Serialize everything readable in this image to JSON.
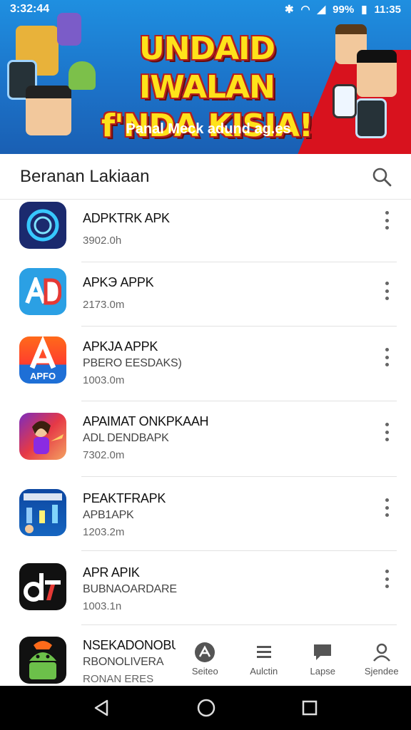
{
  "status_bar": {
    "time_left": "3:32:44",
    "battery": "99%",
    "time_right": "11:35"
  },
  "banner": {
    "title_line1": "UNDAID IWALAN",
    "title_line2": "f'NDA KISIA!",
    "subtitle": "Panal Meck adund ag.es"
  },
  "header": {
    "title": "Beranan Lakiaan"
  },
  "apps": [
    {
      "name": "ADPKTRK APK",
      "desc": "",
      "size": "3902.0h",
      "icon": "circle-app-icon"
    },
    {
      "name": "APKЭ APPK",
      "desc": "",
      "size": "2173.0m",
      "icon": "ad-app-icon"
    },
    {
      "name": "APKJA APPK",
      "desc": "PBERO EESDAKS)",
      "size": "1003.0m",
      "icon": "apfo-app-icon"
    },
    {
      "name": "APAIMAT ONKPKAAH",
      "desc": "ADL DENDBAPK",
      "size": "7302.0m",
      "icon": "game-app-icon"
    },
    {
      "name": "PEAKTFRAPK",
      "desc": "APB1APK",
      "size": "1203.2m",
      "icon": "blue-game-app-icon"
    },
    {
      "name": "APR APIK",
      "desc": "BUBNAOARDARE",
      "size": "1003.1n",
      "icon": "dt-app-icon"
    },
    {
      "name": "NSEKADONOBUB",
      "desc": "RBONOLIVERA",
      "size": "RONAN ERES",
      "icon": "android-app-icon"
    }
  ],
  "bottom_nav": [
    {
      "label": "Seiteo",
      "icon": "apps-icon"
    },
    {
      "label": "Aulctin",
      "icon": "list-icon"
    },
    {
      "label": "Lapse",
      "icon": "chat-icon"
    },
    {
      "label": "Sjendee",
      "icon": "profile-icon"
    }
  ],
  "colors": {
    "banner_blue": "#1c73c9",
    "banner_red": "#d8121e",
    "title_yellow": "#ffe21a"
  }
}
